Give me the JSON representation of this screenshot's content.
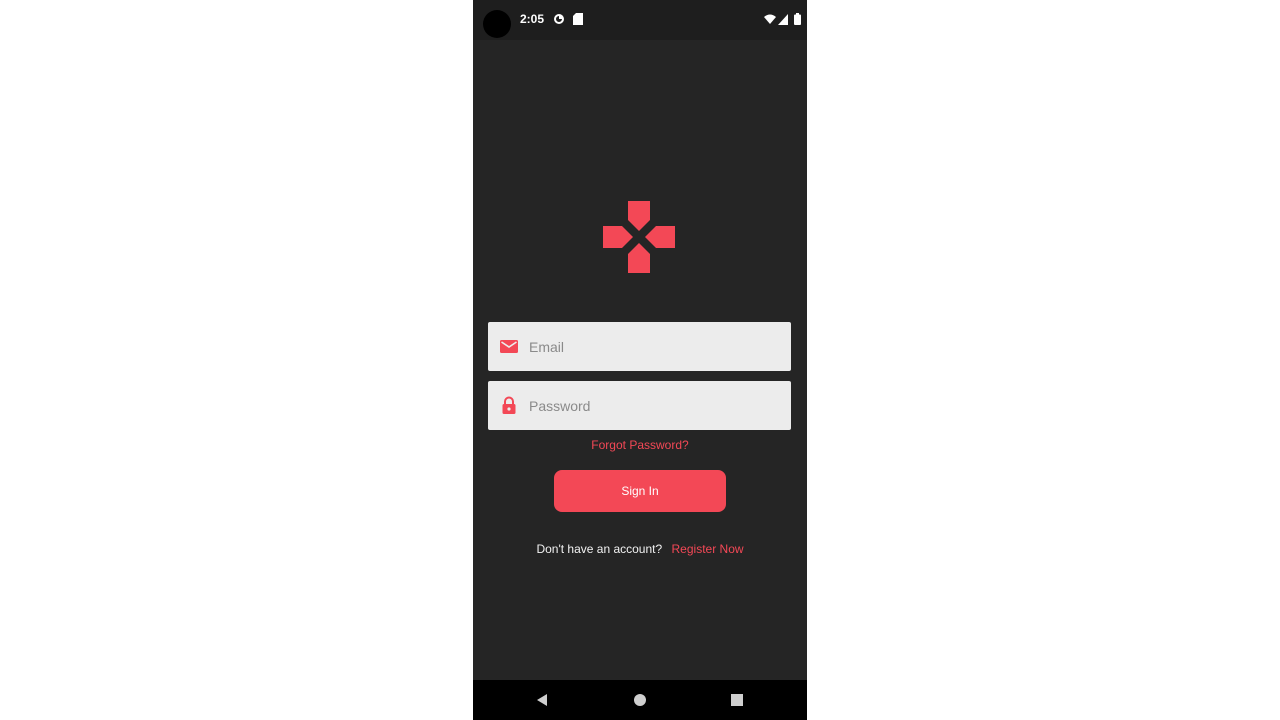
{
  "status_bar": {
    "time": "2:05"
  },
  "colors": {
    "accent": "#f34856",
    "background": "#252525",
    "field_background": "#ececec"
  },
  "icons": {
    "logo": "dpad-logo-icon",
    "email": "mail-icon",
    "password": "lock-icon"
  },
  "login": {
    "email_placeholder": "Email",
    "email_value": "",
    "password_placeholder": "Password",
    "password_value": "",
    "forgot_label": "Forgot Password?",
    "signin_label": "Sign In",
    "register_prompt": "Don't have an account?",
    "register_link": "Register Now"
  }
}
